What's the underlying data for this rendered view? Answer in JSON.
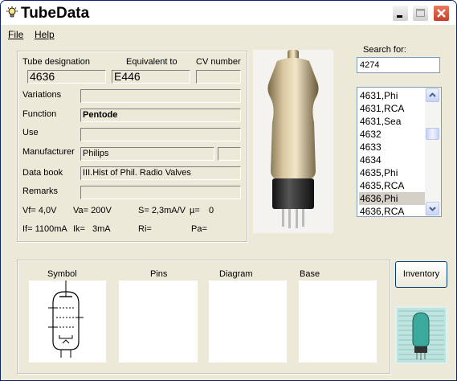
{
  "window": {
    "title": "TubeData"
  },
  "menu": {
    "file": "File",
    "help": "Help"
  },
  "fields": {
    "tube_designation_label": "Tube designation",
    "tube_designation": "4636",
    "equivalent_label": "Equivalent to",
    "equivalent": "E446",
    "cv_label": "CV number",
    "cv": "",
    "variations_label": "Variations",
    "variations": "",
    "function_label": "Function",
    "function": "Pentode",
    "use_label": "Use",
    "use": "",
    "manufacturer_label": "Manufacturer",
    "manufacturer": "Philips",
    "manufacturer_extra": "",
    "databook_label": "Data book",
    "databook": "III.Hist of Phil. Radio Valves",
    "remarks_label": "Remarks",
    "remarks": ""
  },
  "specs": {
    "vf": "Vf= 4,0V",
    "va": "Va= 200V",
    "s": "S= 2,3mA/V",
    "mu": "µ=",
    "mu_val": "0",
    "if": "If= 1100mA",
    "ik": "Ik=",
    "ik_val": "3mA",
    "ri": "Ri=",
    "pa": "Pa="
  },
  "search": {
    "label": "Search for:",
    "value": "4274",
    "results": [
      "4631,Phi",
      "4631,RCA",
      "4631,Sea",
      "4632",
      "4633",
      "4634",
      "4635,Phi",
      "4635,RCA",
      "4636,Phi",
      "4636,RCA"
    ],
    "selected_index": 8
  },
  "bottom": {
    "symbol": "Symbol",
    "pins": "Pins",
    "diagram": "Diagram",
    "base": "Base"
  },
  "inventory_button": "Inventory",
  "colors": {
    "titlebar_close": "#c6402b",
    "selection": "#d4d0c8",
    "panel_bg": "#ece9d8"
  }
}
